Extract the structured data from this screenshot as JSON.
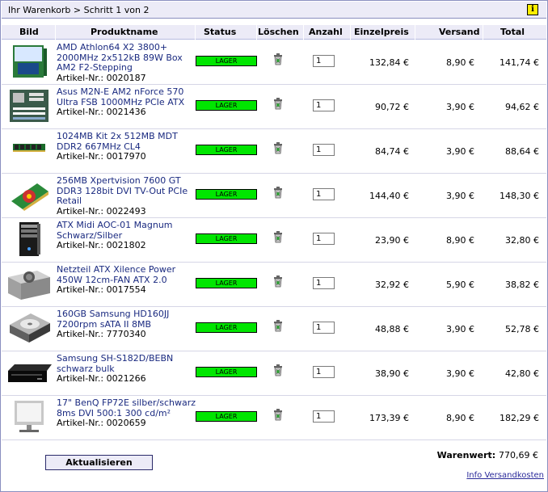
{
  "titlebar": {
    "breadcrumb": "Ihr Warenkorb > Schritt 1 von 2",
    "info_label": "i"
  },
  "columns": {
    "bild": "Bild",
    "produktname": "Produktname",
    "status": "Status",
    "loeschen": "Löschen",
    "anzahl": "Anzahl",
    "einzelpreis": "Einzelpreis",
    "versand": "Versand",
    "total": "Total"
  },
  "items": [
    {
      "name": "AMD Athlon64 X2 3800+ 2000MHz 2x512kB 89W Box AM2 F2-Stepping",
      "artikel": "Artikel-Nr.: 0020187",
      "status": "LAGER",
      "qty": "1",
      "einzelpreis": "132,84 €",
      "versand": "8,90 €",
      "total": "141,74 €",
      "thumb": "cpu-box"
    },
    {
      "name": "Asus M2N-E AM2 nForce 570 Ultra FSB 1000MHz PCIe ATX",
      "artikel": "Artikel-Nr.: 0021436",
      "status": "LAGER",
      "qty": "1",
      "einzelpreis": "90,72 €",
      "versand": "3,90 €",
      "total": "94,62 €",
      "thumb": "mainboard"
    },
    {
      "name": "1024MB Kit 2x 512MB MDT DDR2 667MHz CL4",
      "artikel": "Artikel-Nr.: 0017970",
      "status": "LAGER",
      "qty": "1",
      "einzelpreis": "84,74 €",
      "versand": "3,90 €",
      "total": "88,64 €",
      "thumb": "ram"
    },
    {
      "name": "256MB Xpertvision 7600 GT DDR3 128bit DVI TV-Out PCIe Retail",
      "artikel": "Artikel-Nr.: 0022493",
      "status": "LAGER",
      "qty": "1",
      "einzelpreis": "144,40 €",
      "versand": "3,90 €",
      "total": "148,30 €",
      "thumb": "gpu"
    },
    {
      "name": "ATX Midi AOC-01 Magnum Schwarz/Silber",
      "artikel": "Artikel-Nr.: 0021802",
      "status": "LAGER",
      "qty": "1",
      "einzelpreis": "23,90 €",
      "versand": "8,90 €",
      "total": "32,80 €",
      "thumb": "case"
    },
    {
      "name": "Netzteil ATX Xilence Power 450W 12cm-FAN ATX 2.0",
      "artikel": "Artikel-Nr.: 0017554",
      "status": "LAGER",
      "qty": "1",
      "einzelpreis": "32,92 €",
      "versand": "5,90 €",
      "total": "38,82 €",
      "thumb": "psu"
    },
    {
      "name": "160GB Samsung HD160JJ 7200rpm sATA II 8MB",
      "artikel": "Artikel-Nr.: 7770340",
      "status": "LAGER",
      "qty": "1",
      "einzelpreis": "48,88 €",
      "versand": "3,90 €",
      "total": "52,78 €",
      "thumb": "hdd"
    },
    {
      "name": "Samsung SH-S182D/BEBN schwarz bulk",
      "artikel": "Artikel-Nr.: 0021266",
      "status": "LAGER",
      "qty": "1",
      "einzelpreis": "38,90 €",
      "versand": "3,90 €",
      "total": "42,80 €",
      "thumb": "dvd"
    },
    {
      "name": "17\" BenQ FP72E silber/schwarz 8ms DVI 500:1 300 cd/m²",
      "artikel": "Artikel-Nr.: 0020659",
      "status": "LAGER",
      "qty": "1",
      "einzelpreis": "173,39 €",
      "versand": "8,90 €",
      "total": "182,29 €",
      "thumb": "monitor"
    }
  ],
  "footer": {
    "warenwert_label": "Warenwert:",
    "warenwert_value": "770,69 €",
    "update_button": "Aktualisieren",
    "shipping_link": "Info Versandkosten"
  }
}
